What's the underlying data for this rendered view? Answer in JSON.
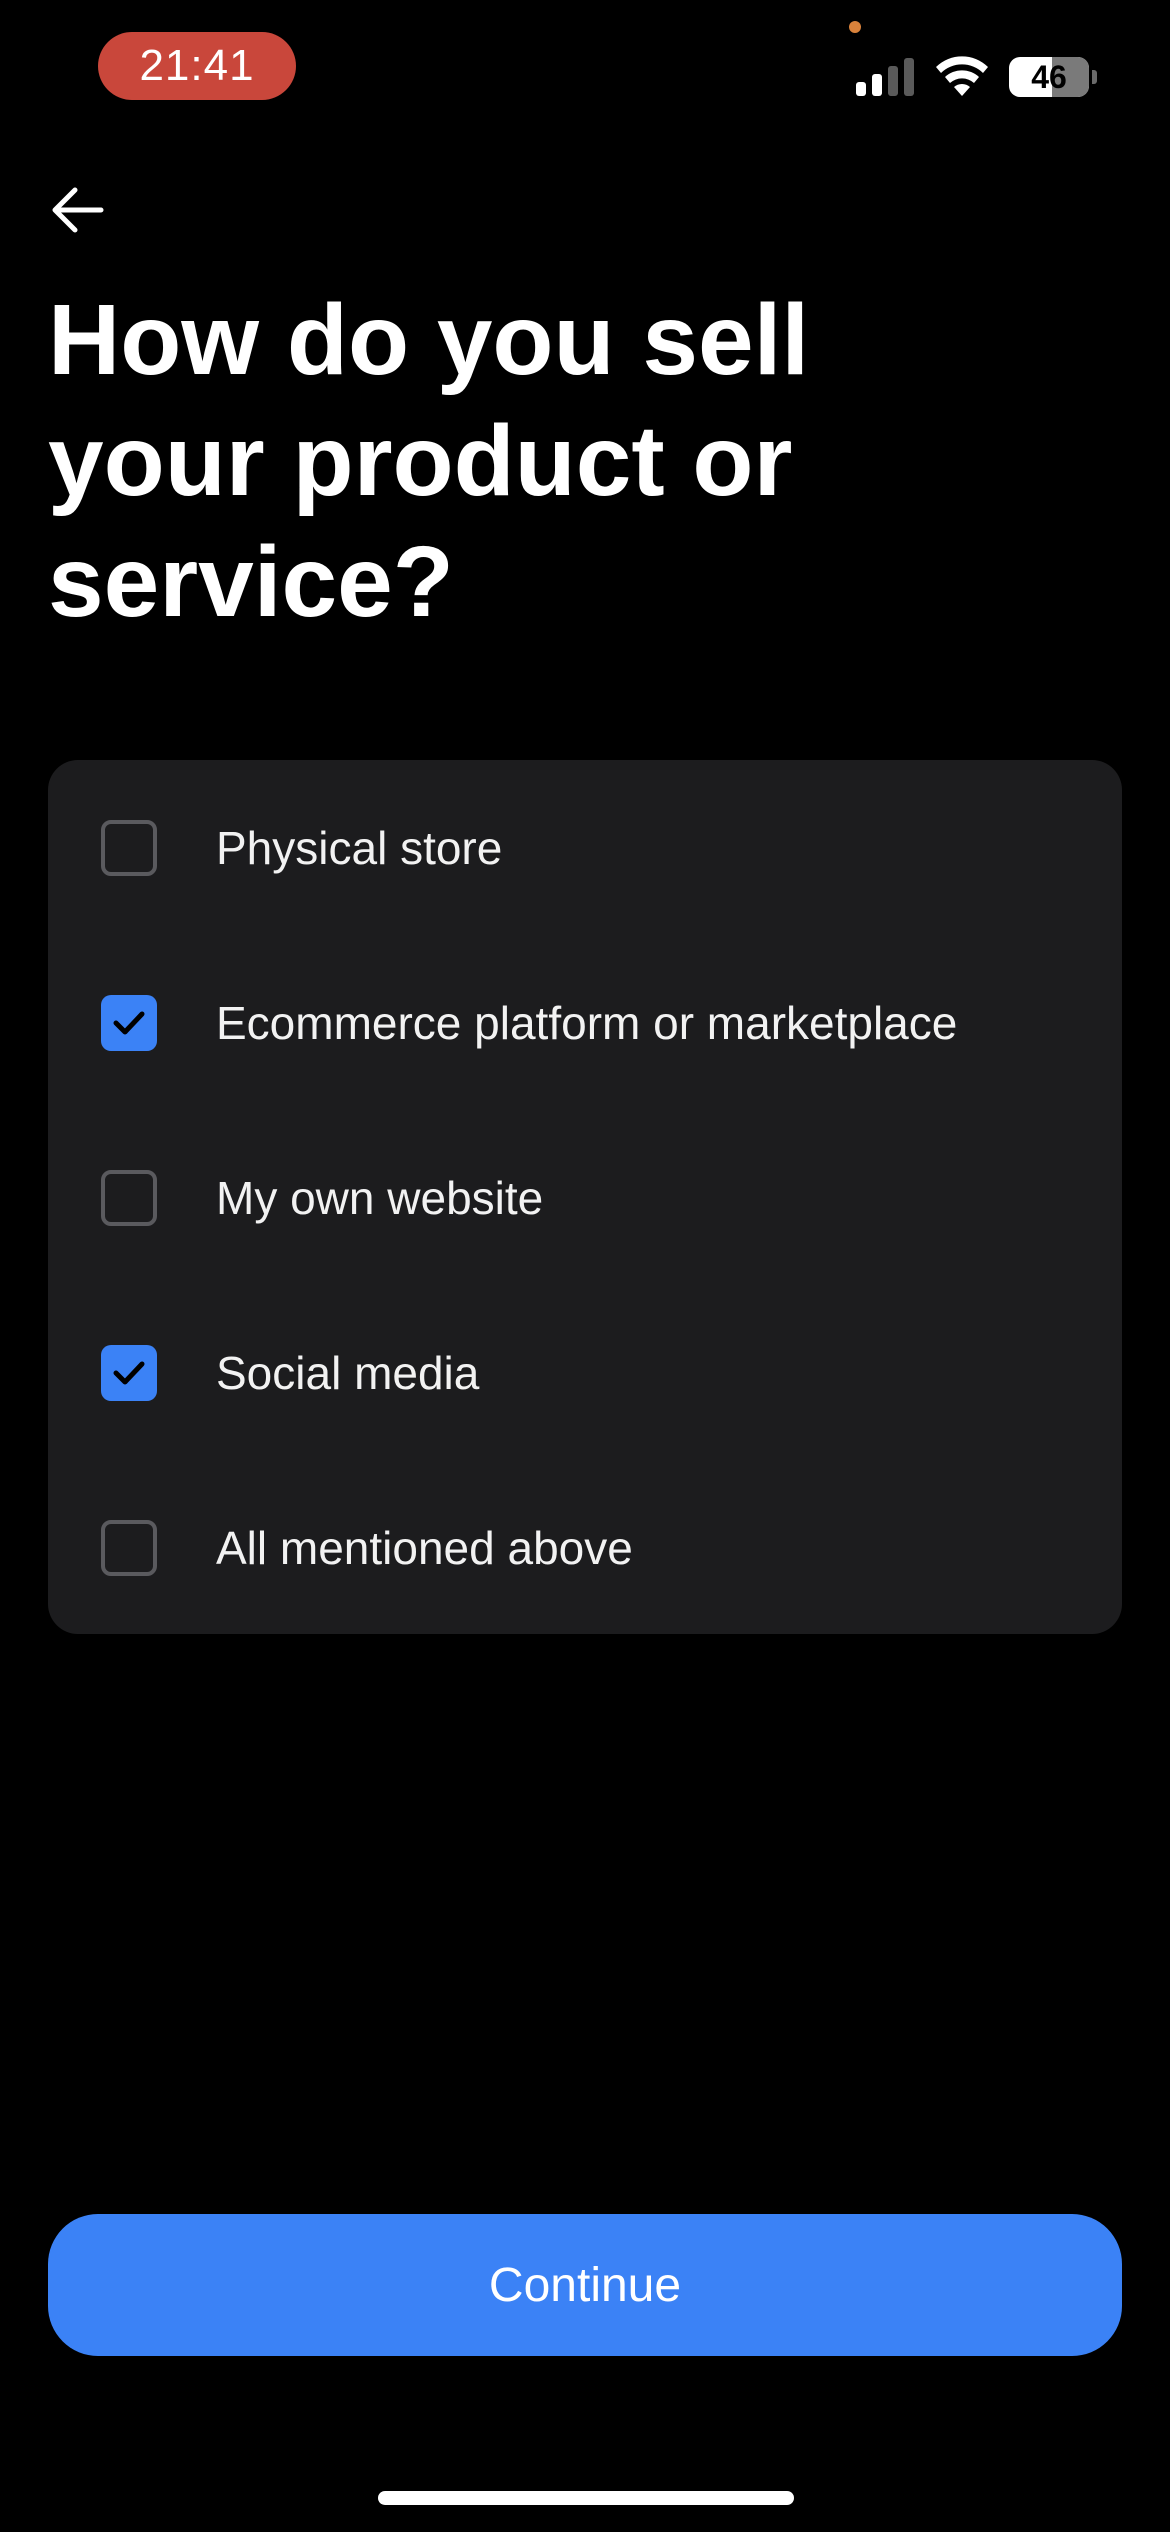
{
  "status_bar": {
    "time": "21:41",
    "battery": "46",
    "battery_level_percent": 46,
    "signal_bars_active": 2,
    "signal_bars_total": 4
  },
  "navigation": {
    "back_icon": "arrow-left-icon"
  },
  "page": {
    "title": "How do you sell your product or service?"
  },
  "options": [
    {
      "label": "Physical store",
      "checked": false
    },
    {
      "label": "Ecommerce platform or marketplace",
      "checked": true
    },
    {
      "label": "My own website",
      "checked": false
    },
    {
      "label": "Social media",
      "checked": true
    },
    {
      "label": "All mentioned above",
      "checked": false
    }
  ],
  "footer": {
    "continue_label": "Continue"
  },
  "colors": {
    "background": "#000000",
    "card": "#1c1c1e",
    "accent": "#3b82f6",
    "time_pill": "#c9473b"
  }
}
